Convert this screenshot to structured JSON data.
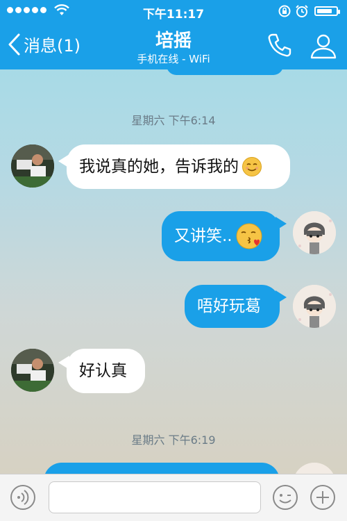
{
  "status_bar": {
    "time": "下午11:17",
    "signal_icon": "signal-dots-icon",
    "wifi_icon": "wifi-icon",
    "battery_icon": "battery-icon",
    "battery_level": 0.8
  },
  "nav": {
    "back_label": "消息(1)",
    "title": "培摇",
    "subtitle": "手机在线 - WiFi",
    "call_icon": "phone-icon",
    "profile_icon": "person-icon"
  },
  "messages": [
    {
      "type": "timestamp",
      "text": "星期六 下午6:14"
    },
    {
      "type": "in",
      "text": "我说真的她，告诉我的",
      "emoji": "smile-emoji"
    },
    {
      "type": "out",
      "text": "又讲笑..",
      "emoji": "kiss-emoji"
    },
    {
      "type": "out",
      "text": "唔好玩葛"
    },
    {
      "type": "in",
      "text": "好认真"
    },
    {
      "type": "timestamp",
      "text": "星期六 下午6:19"
    }
  ],
  "input": {
    "placeholder": "",
    "value": ""
  },
  "colors": {
    "accent": "#1aa0e8",
    "incoming_bubble": "#ffffff",
    "timestamp_text": "#6a7b87"
  }
}
